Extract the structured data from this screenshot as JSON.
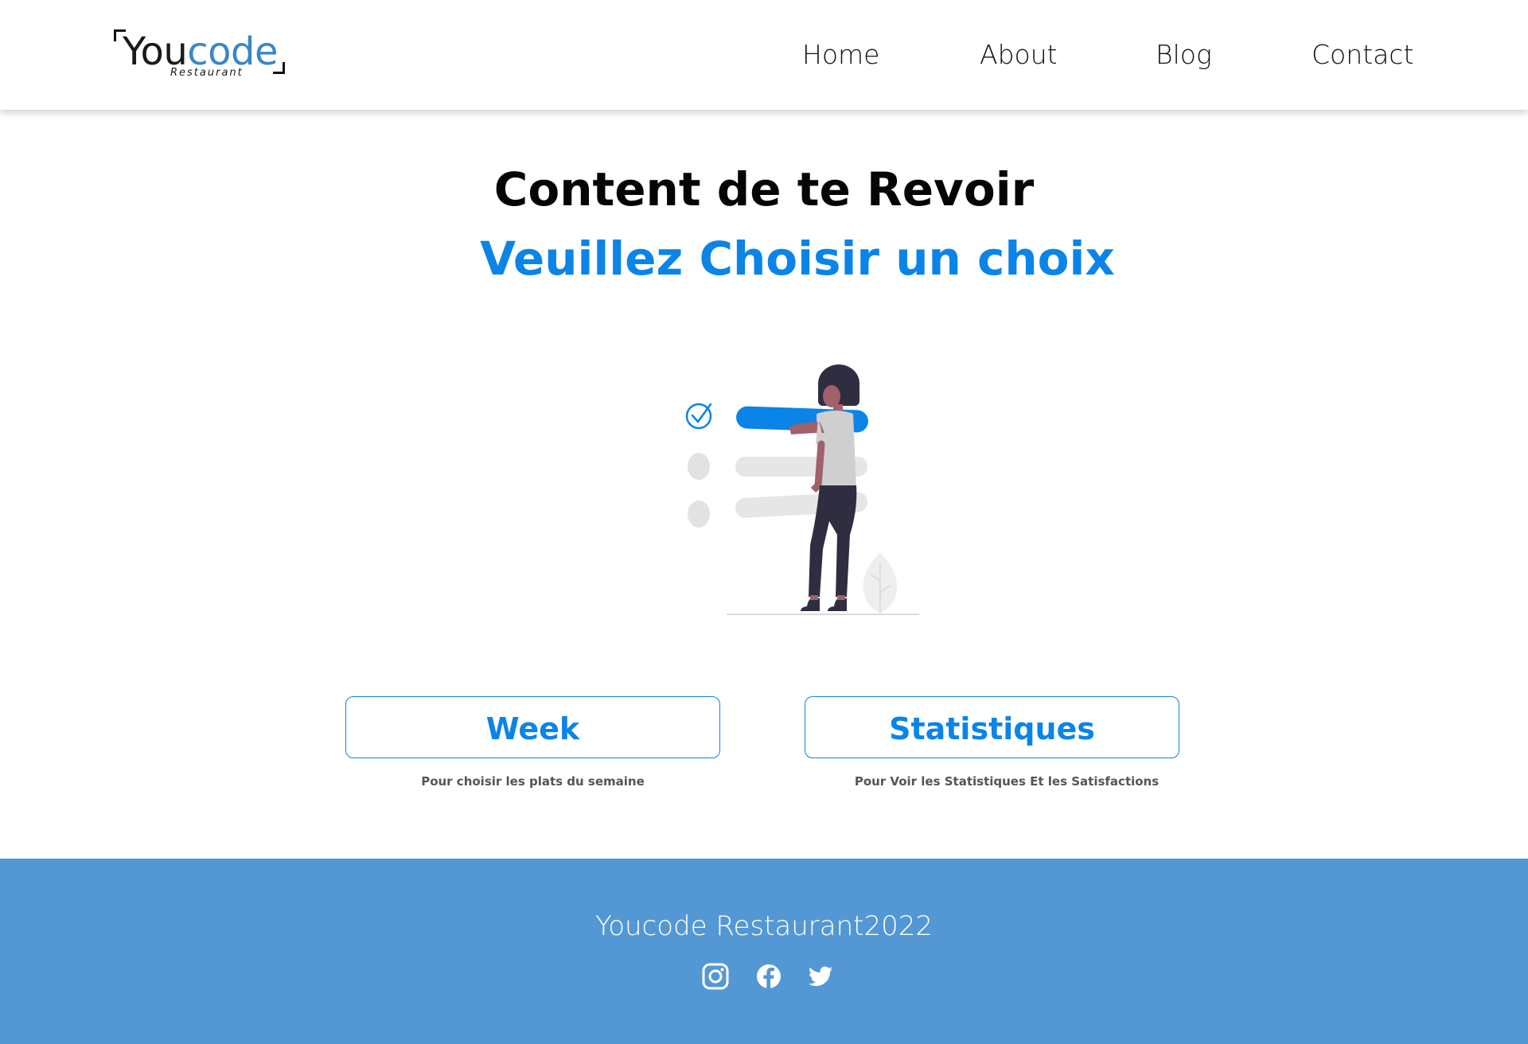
{
  "brand": {
    "logo_you": "You",
    "logo_code": "code",
    "logo_sub": "Restaurant",
    "accent_color": "#0b84e8",
    "footer_color": "#5398d4"
  },
  "nav": {
    "items": [
      {
        "label": "Home"
      },
      {
        "label": "About"
      },
      {
        "label": "Blog"
      },
      {
        "label": "Contact"
      }
    ]
  },
  "hero": {
    "title": "Content de te Revoir",
    "subtitle": "Veuillez Choisir un choix",
    "illustration": "checklist-woman-illustration"
  },
  "choices": [
    {
      "label": "Week",
      "description": "Pour choisir les plats du semaine"
    },
    {
      "label": "Statistiques",
      "description": "Pour Voir les Statistiques Et les Satisfactions"
    }
  ],
  "footer": {
    "text": "Youcode Restaurant2022",
    "social_icons": [
      "instagram-icon",
      "facebook-icon",
      "twitter-icon"
    ]
  }
}
